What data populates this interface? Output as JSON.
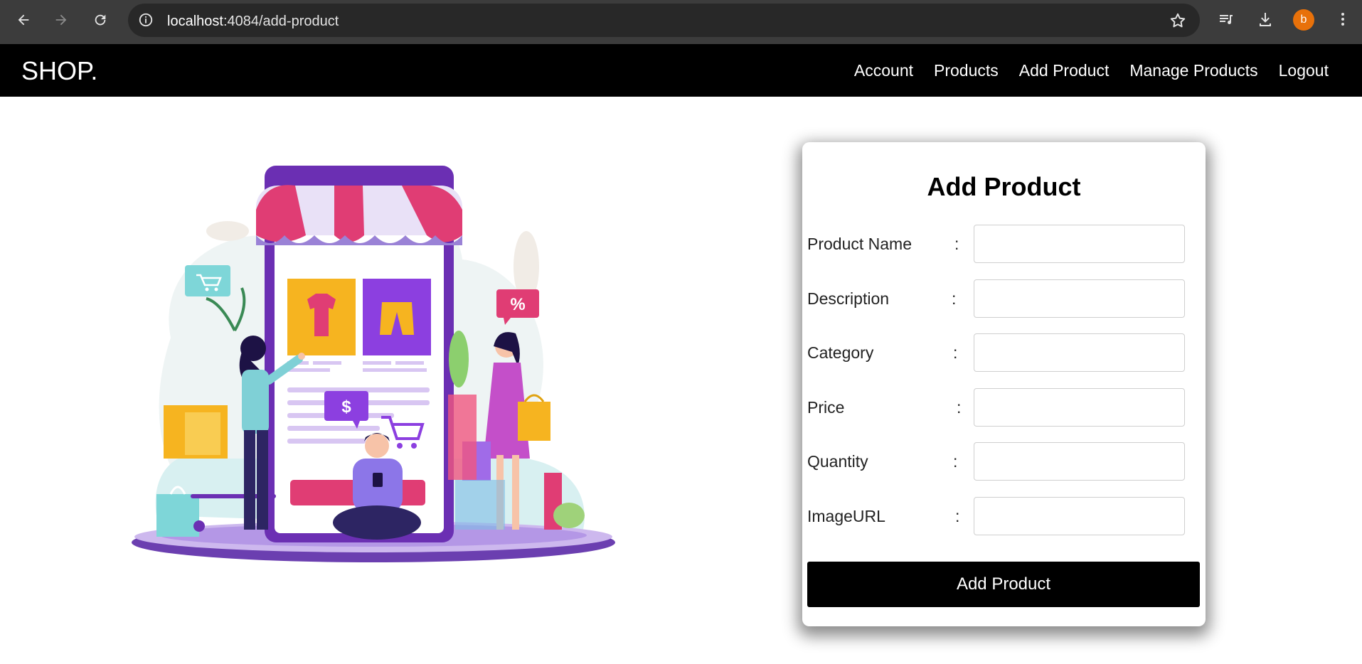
{
  "browser": {
    "url_host": "localhost",
    "url_path": ":4084/add-product",
    "avatar_letter": "b",
    "avatar_color": "#e8710a"
  },
  "navbar": {
    "brand": "SHOP.",
    "links": [
      "Account",
      "Products",
      "Add Product",
      "Manage Products",
      "Logout"
    ]
  },
  "illustration": {
    "subject": "shopping-app-illustration",
    "tag_percent": "%",
    "tag_dollar": "$"
  },
  "form": {
    "title": "Add Product",
    "fields": [
      {
        "label": "Product Name",
        "colon": ":",
        "value": ""
      },
      {
        "label": "Description",
        "colon": ":",
        "value": ""
      },
      {
        "label": "Category",
        "colon": ":",
        "value": ""
      },
      {
        "label": "Price",
        "colon": ":",
        "value": ""
      },
      {
        "label": "Quantity",
        "colon": ":",
        "value": ""
      },
      {
        "label": "ImageURL",
        "colon": ":",
        "value": ""
      }
    ],
    "submit_label": "Add Product"
  }
}
